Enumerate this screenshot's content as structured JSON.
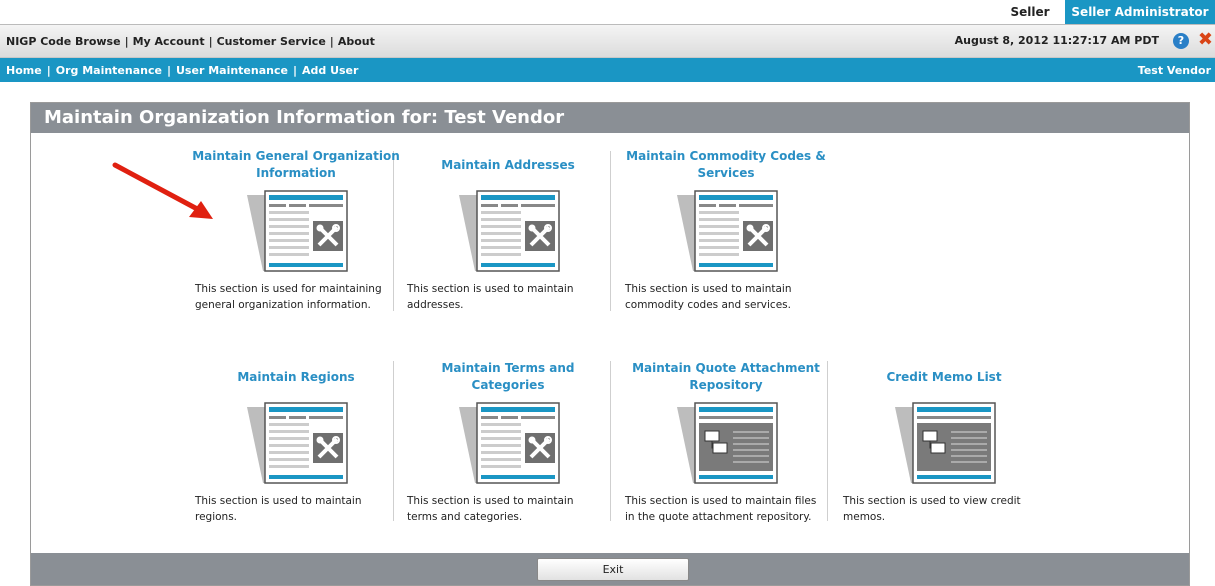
{
  "role_tabs": {
    "seller": "Seller",
    "admin": "Seller Administrator"
  },
  "top_nav": {
    "links": [
      "NIGP Code Browse",
      "My Account",
      "Customer Service",
      "About"
    ],
    "datetime": "August 8, 2012 11:27:17 AM PDT"
  },
  "sub_nav": {
    "links": [
      "Home",
      "Org Maintenance",
      "User Maintenance",
      "Add User"
    ],
    "vendor": "Test Vendor"
  },
  "panel": {
    "title": "Maintain Organization Information for: Test Vendor",
    "exit_label": "Exit"
  },
  "cards": [
    {
      "title": "Maintain General Organization Information",
      "icon": "tools-icon",
      "desc": "This section is used for maintaining general organization information."
    },
    {
      "title": "Maintain Addresses",
      "icon": "tools-icon",
      "desc": "This section is used to maintain addresses."
    },
    {
      "title": "Maintain Commodity Codes & Services",
      "icon": "tools-icon",
      "desc": "This section is used to maintain commodity codes and services."
    },
    {
      "title": "Maintain Regions",
      "icon": "tools-icon",
      "desc": "This section is used to maintain regions."
    },
    {
      "title": "Maintain Terms and Categories",
      "icon": "tools-icon",
      "desc": "This section is used to maintain terms and categories."
    },
    {
      "title": "Maintain Quote Attachment Repository",
      "icon": "files-icon",
      "desc": "This section is used to maintain files in the quote attachment repository."
    },
    {
      "title": "Credit Memo List",
      "icon": "files-icon",
      "desc": "This section is used to view credit memos."
    }
  ],
  "colors": {
    "accent": "#1a96c4",
    "header_gray": "#8a8f95",
    "link_blue": "#2a8fc4",
    "arrow_red": "#e02010"
  }
}
